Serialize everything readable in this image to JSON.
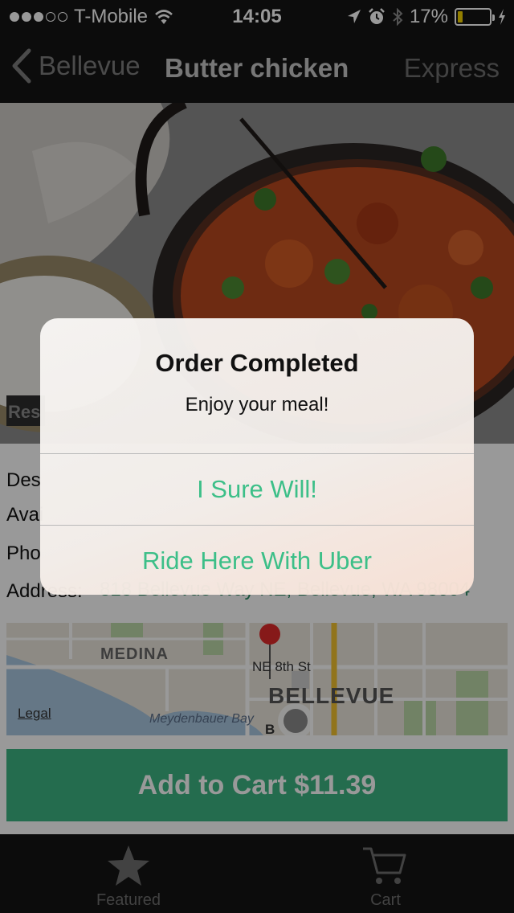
{
  "status_bar": {
    "carrier": "T-Mobile",
    "time": "14:05",
    "battery": "17%",
    "battery_level": 0.17
  },
  "nav": {
    "back_label": "Bellevue",
    "title": "Butter chicken",
    "right_label": "Express"
  },
  "hero": {
    "badge_text": "Res"
  },
  "details": {
    "description_label": "Des",
    "availability_label": "Avai",
    "phone_label": "Pho",
    "address_label": "Address:",
    "address_value": "818 Bellevue Way NE, Bellevue, WA 98004"
  },
  "map": {
    "legal": "Legal",
    "area_label": "MEDINA",
    "street_label": "NE 8th St",
    "city_label": "BELLEVUE",
    "water_label": "Meydenbauer Bay",
    "b_label": "B"
  },
  "add_to_cart": {
    "label": "Add to Cart $11.39"
  },
  "tabs": [
    {
      "label": "Featured",
      "icon": "star-icon"
    },
    {
      "label": "Cart",
      "icon": "cart-icon"
    }
  ],
  "alert": {
    "title": "Order Completed",
    "message": "Enjoy your meal!",
    "buttons": [
      "I Sure Will!",
      "Ride Here With Uber"
    ]
  },
  "colors": {
    "accent": "#3cb483",
    "bar_background": "#151515"
  }
}
